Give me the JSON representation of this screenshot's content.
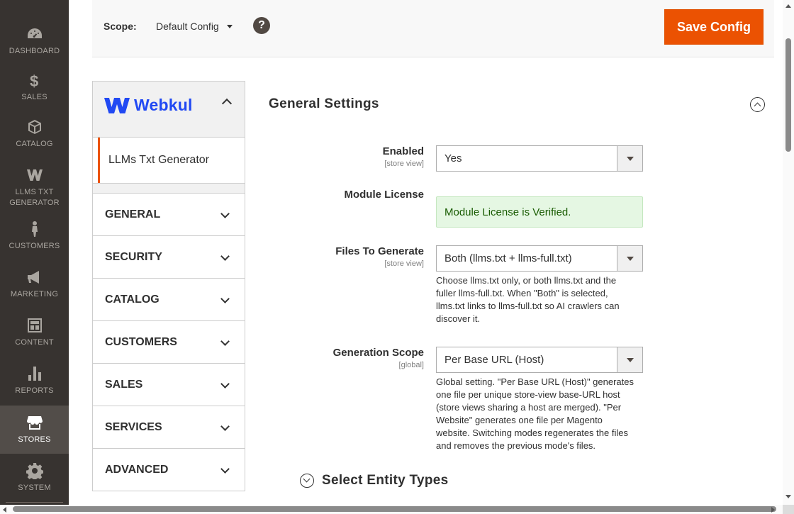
{
  "admin_nav": {
    "items": [
      {
        "label": "DASHBOARD",
        "icon": "dashboard-icon"
      },
      {
        "label": "SALES",
        "icon": "dollar-icon"
      },
      {
        "label": "CATALOG",
        "icon": "box-icon"
      },
      {
        "label": "LLMS TXT GENERATOR",
        "line1": "LLMS TXT",
        "line2": "GENERATOR",
        "icon": "webkul-w-icon"
      },
      {
        "label": "CUSTOMERS",
        "icon": "person-icon"
      },
      {
        "label": "MARKETING",
        "icon": "megaphone-icon"
      },
      {
        "label": "CONTENT",
        "icon": "layout-icon"
      },
      {
        "label": "REPORTS",
        "icon": "bar-chart-icon"
      },
      {
        "label": "STORES",
        "icon": "store-icon",
        "active": true
      },
      {
        "label": "SYSTEM",
        "icon": "gear-icon"
      }
    ]
  },
  "header": {
    "scope_label": "Scope:",
    "scope_value": "Default Config",
    "help_glyph": "?",
    "save_label": "Save Config"
  },
  "config_tabs": {
    "group_name": "Webkul",
    "active_item": "LLMs Txt Generator",
    "sections": [
      "GENERAL",
      "SECURITY",
      "CATALOG",
      "CUSTOMERS",
      "SALES",
      "SERVICES",
      "ADVANCED"
    ]
  },
  "main": {
    "section_title": "General Settings",
    "fields": {
      "enabled": {
        "label": "Enabled",
        "scope": "[store view]",
        "value": "Yes"
      },
      "license": {
        "label": "Module License",
        "value": "Module License is Verified."
      },
      "files": {
        "label": "Files To Generate",
        "scope": "[store view]",
        "value": "Both (llms.txt + llms-full.txt)",
        "note_lines": [
          "Choose llms.txt only, or both llms.txt and the",
          "fuller llms-full.txt. When \"Both\" is selected,",
          "llms.txt links to llms-full.txt so AI crawlers can",
          "discover it."
        ]
      },
      "scope": {
        "label": "Generation Scope",
        "scope": "[global]",
        "value": "Per Base URL (Host)",
        "note_lines": [
          "Global setting. \"Per Base URL (Host)\" generates",
          "one file per unique store-view base-URL host",
          "(store views sharing a host are merged). \"Per",
          "Website\" generates one file per Magento",
          "website. Switching modes regenerates the files",
          "and removes the previous mode's files."
        ]
      }
    },
    "entity_heading": "Select Entity Types"
  },
  "colors": {
    "sidebar_bg": "#373330",
    "sidebar_active_bg": "#524d49",
    "accent_orange": "#eb5202",
    "webkul_blue": "#2149f3",
    "success_bg": "#e5f7e3",
    "success_text": "#185b00"
  }
}
